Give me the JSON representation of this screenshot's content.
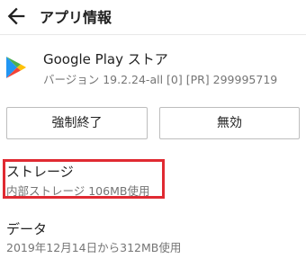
{
  "header": {
    "title": "アプリ情報",
    "back_icon": "arrow-back-icon"
  },
  "app": {
    "name": "Google Play ストア",
    "version": "バージョン 19.2.24-all [0] [PR] 299995719",
    "icon": "google-play-icon"
  },
  "buttons": {
    "force_stop": "強制終了",
    "disable": "無効"
  },
  "storage": {
    "title": "ストレージ",
    "summary": "内部ストレージ 106MB使用",
    "highlight_color": "#e02a32"
  },
  "data_usage": {
    "title": "データ",
    "summary": "2019年12月14日から312MB使用"
  }
}
